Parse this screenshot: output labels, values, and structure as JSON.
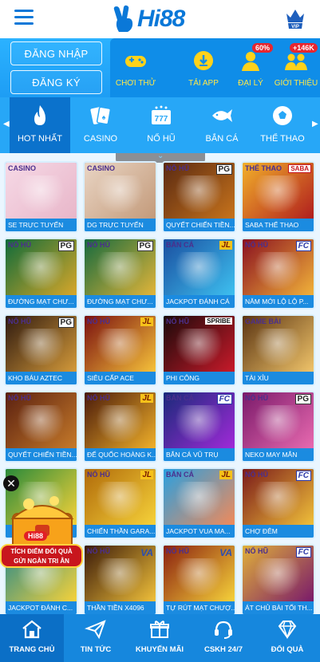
{
  "header": {
    "logo_text": "Hi88",
    "vip_label": "VIP"
  },
  "auth": {
    "login_label": "ĐĂNG NHẬP",
    "register_label": "ĐĂNG KÝ"
  },
  "quick_actions": [
    {
      "label": "CHƠI THỬ",
      "icon": "gamepad-icon",
      "badge": ""
    },
    {
      "label": "TẢI APP",
      "icon": "download-icon",
      "badge": ""
    },
    {
      "label": "ĐẠI LÝ",
      "icon": "agent-icon",
      "badge": "60%"
    },
    {
      "label": "GIỚI THIỆU",
      "icon": "referral-icon",
      "badge": "+146K"
    }
  ],
  "categories": [
    {
      "label": "HOT NHẤT",
      "icon": "flame-icon",
      "active": true
    },
    {
      "label": "CASINO",
      "icon": "cards-icon",
      "active": false
    },
    {
      "label": "NỔ HŨ",
      "icon": "slot-777-icon",
      "active": false
    },
    {
      "label": "BẮN CÁ",
      "icon": "fish-icon",
      "active": false
    },
    {
      "label": "THỂ THAO",
      "icon": "soccer-ball-icon",
      "active": false
    }
  ],
  "games": [
    {
      "cat": "CASINO",
      "provider": "",
      "name": "SE TRỰC TUYẾN"
    },
    {
      "cat": "CASINO",
      "provider": "",
      "name": "DG TRỰC TUYẾN"
    },
    {
      "cat": "NỔ HŨ",
      "provider": "PG",
      "name": "QUYẾT CHIẾN TIỀN..."
    },
    {
      "cat": "THỂ THAO",
      "provider": "SABA",
      "name": "SABA THỂ THAO"
    },
    {
      "cat": "NỔ HŨ",
      "provider": "PG",
      "name": "ĐƯỜNG MẠT CHƯ..."
    },
    {
      "cat": "NỔ HŨ",
      "provider": "PG",
      "name": "ĐƯỜNG MẠT CHƯ..."
    },
    {
      "cat": "BẮN CÁ",
      "provider": "JL",
      "name": "JACKPOT ĐÁNH CÁ"
    },
    {
      "cat": "NỔ HŨ",
      "provider": "FC",
      "name": "NĂM MỚI LỘ LỘ P..."
    },
    {
      "cat": "NỔ HŨ",
      "provider": "PG",
      "name": "KHO BÁU AZTEC"
    },
    {
      "cat": "NỔ HŨ",
      "provider": "JL",
      "name": "SIÊU CẤP ACE"
    },
    {
      "cat": "NỔ HŨ",
      "provider": "SPRIBE",
      "name": "PHI CÔNG"
    },
    {
      "cat": "GAME BÀI",
      "provider": "",
      "name": "TÀI XỈU"
    },
    {
      "cat": "NỔ HŨ",
      "provider": "",
      "name": "QUYẾT CHIẾN TIỀN..."
    },
    {
      "cat": "NỔ HŨ",
      "provider": "JL",
      "name": "ĐẾ QUỐC HOÀNG K..."
    },
    {
      "cat": "BẮN CÁ",
      "provider": "FC",
      "name": "BẮN CÁ VŨ TRỤ"
    },
    {
      "cat": "NỔ HŨ",
      "provider": "PG",
      "name": "NEKO MAY MẮN"
    },
    {
      "cat": "",
      "provider": "",
      "name": ""
    },
    {
      "cat": "NỔ HŨ",
      "provider": "JL",
      "name": "CHIẾN THẦN GARA..."
    },
    {
      "cat": "BẮN CÁ",
      "provider": "JL",
      "name": "JACKPOT VUA MA..."
    },
    {
      "cat": "NỔ HŨ",
      "provider": "FC",
      "name": "CHỢ ĐÊM"
    },
    {
      "cat": "",
      "provider": "",
      "name": "JACKPOT ĐÁNH C..."
    },
    {
      "cat": "NỔ HŨ",
      "provider": "VA",
      "name": "THẦN TIỀN X4096"
    },
    {
      "cat": "NỔ HŨ",
      "provider": "VA",
      "name": "TỰ RÚT MẠT CHƯỢ..."
    },
    {
      "cat": "NỔ HŨ",
      "provider": "FC",
      "name": "ÁT CHỦ BÀI TỐI TH..."
    }
  ],
  "promo": {
    "brand": "Hi88",
    "line1": "TÍCH ĐIỂM ĐỔI QUÀ",
    "line2": "GỬI NGÀN TRI ÂN"
  },
  "bottom_nav": [
    {
      "label": "TRANG CHỦ",
      "icon": "home-icon",
      "active": true
    },
    {
      "label": "TIN TỨC",
      "icon": "paper-plane-icon",
      "active": false
    },
    {
      "label": "KHUYẾN MÃI",
      "icon": "gift-icon",
      "active": false
    },
    {
      "label": "CSKH 24/7",
      "icon": "support-headset-icon",
      "active": false
    },
    {
      "label": "ĐỔI QUÀ",
      "icon": "diamond-icon",
      "active": false
    }
  ],
  "colors": {
    "brand_blue": "#0a78d8",
    "accent_yellow": "#ffe94a",
    "badge_red": "#e8262e"
  }
}
